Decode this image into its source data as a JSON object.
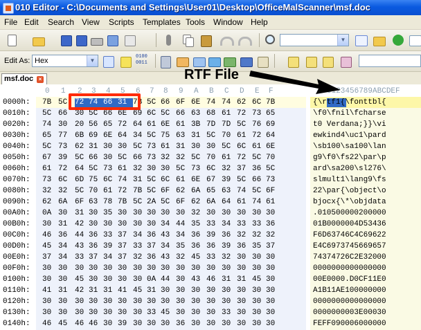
{
  "window": {
    "title": "010 Editor - C:\\Documents and Settings\\User01\\Desktop\\OfficeMalScanner\\msf.doc"
  },
  "menu": [
    "File",
    "Edit",
    "Search",
    "View",
    "Scripts",
    "Templates",
    "Tools",
    "Window",
    "Help"
  ],
  "toolbar": {
    "edit_as_label": "Edit As:",
    "edit_as_value": "Hex",
    "binary_icon_text": "0100\n0011"
  },
  "tab": {
    "label": "msf.doc"
  },
  "annotation": {
    "label": "RTF File"
  },
  "hex": {
    "column_headers": [
      "0",
      "1",
      "2",
      "3",
      "4",
      "5",
      "6",
      "7",
      "8",
      "9",
      "A",
      "B",
      "C",
      "D",
      "E",
      "F"
    ],
    "ascii_header": "0123456789ABCDEF",
    "rows": [
      {
        "addr": "0000h:",
        "bytes": [
          "7B",
          "5C",
          "72",
          "74",
          "66",
          "31",
          "7B",
          "5C",
          "66",
          "6F",
          "6E",
          "74",
          "74",
          "62",
          "6C",
          "7B"
        ],
        "ascii": "{\\rtf1{\\fonttbl{"
      },
      {
        "addr": "0010h:",
        "bytes": [
          "5C",
          "66",
          "30",
          "5C",
          "66",
          "6E",
          "69",
          "6C",
          "5C",
          "66",
          "63",
          "68",
          "61",
          "72",
          "73",
          "65"
        ],
        "ascii": "\\f0\\fnil\\fcharse"
      },
      {
        "addr": "0020h:",
        "bytes": [
          "74",
          "30",
          "20",
          "56",
          "65",
          "72",
          "64",
          "61",
          "6E",
          "61",
          "3B",
          "7D",
          "7D",
          "5C",
          "76",
          "69"
        ],
        "ascii": "t0 Verdana;}}\\vi"
      },
      {
        "addr": "0030h:",
        "bytes": [
          "65",
          "77",
          "6B",
          "69",
          "6E",
          "64",
          "34",
          "5C",
          "75",
          "63",
          "31",
          "5C",
          "70",
          "61",
          "72",
          "64"
        ],
        "ascii": "ewkind4\\uc1\\pard"
      },
      {
        "addr": "0040h:",
        "bytes": [
          "5C",
          "73",
          "62",
          "31",
          "30",
          "30",
          "5C",
          "73",
          "61",
          "31",
          "30",
          "30",
          "5C",
          "6C",
          "61",
          "6E"
        ],
        "ascii": "\\sb100\\sa100\\lan"
      },
      {
        "addr": "0050h:",
        "bytes": [
          "67",
          "39",
          "5C",
          "66",
          "30",
          "5C",
          "66",
          "73",
          "32",
          "32",
          "5C",
          "70",
          "61",
          "72",
          "5C",
          "70"
        ],
        "ascii": "g9\\f0\\fs22\\par\\p"
      },
      {
        "addr": "0060h:",
        "bytes": [
          "61",
          "72",
          "64",
          "5C",
          "73",
          "61",
          "32",
          "30",
          "30",
          "5C",
          "73",
          "6C",
          "32",
          "37",
          "36",
          "5C"
        ],
        "ascii": "ard\\sa200\\sl276\\"
      },
      {
        "addr": "0070h:",
        "bytes": [
          "73",
          "6C",
          "6D",
          "75",
          "6C",
          "74",
          "31",
          "5C",
          "6C",
          "61",
          "6E",
          "67",
          "39",
          "5C",
          "66",
          "73"
        ],
        "ascii": "slmult1\\lang9\\fs"
      },
      {
        "addr": "0080h:",
        "bytes": [
          "32",
          "32",
          "5C",
          "70",
          "61",
          "72",
          "7B",
          "5C",
          "6F",
          "62",
          "6A",
          "65",
          "63",
          "74",
          "5C",
          "6F"
        ],
        "ascii": "22\\par{\\object\\o"
      },
      {
        "addr": "0090h:",
        "bytes": [
          "62",
          "6A",
          "6F",
          "63",
          "78",
          "7B",
          "5C",
          "2A",
          "5C",
          "6F",
          "62",
          "6A",
          "64",
          "61",
          "74",
          "61"
        ],
        "ascii": "bjocx{\\*\\objdata"
      },
      {
        "addr": "00A0h:",
        "bytes": [
          "0A",
          "30",
          "31",
          "30",
          "35",
          "30",
          "30",
          "30",
          "30",
          "30",
          "32",
          "30",
          "30",
          "30",
          "30",
          "30"
        ],
        "ascii": ".010500000200000"
      },
      {
        "addr": "00B0h:",
        "bytes": [
          "30",
          "31",
          "42",
          "30",
          "30",
          "30",
          "30",
          "30",
          "34",
          "44",
          "35",
          "33",
          "34",
          "33",
          "33",
          "36"
        ],
        "ascii": "01B0000004D53436"
      },
      {
        "addr": "00C0h:",
        "bytes": [
          "46",
          "36",
          "44",
          "36",
          "33",
          "37",
          "34",
          "36",
          "43",
          "34",
          "36",
          "39",
          "36",
          "32",
          "32",
          "32"
        ],
        "ascii": "F6D63746C4C69622"
      },
      {
        "addr": "00D0h:",
        "bytes": [
          "45",
          "34",
          "43",
          "36",
          "39",
          "37",
          "33",
          "37",
          "34",
          "35",
          "36",
          "36",
          "39",
          "36",
          "35",
          "37"
        ],
        "ascii": "E4C6973745669657"
      },
      {
        "addr": "00E0h:",
        "bytes": [
          "37",
          "34",
          "33",
          "37",
          "34",
          "37",
          "32",
          "36",
          "43",
          "32",
          "45",
          "33",
          "32",
          "30",
          "30",
          "30"
        ],
        "ascii": "74374726C2E32000"
      },
      {
        "addr": "00F0h:",
        "bytes": [
          "30",
          "30",
          "30",
          "30",
          "30",
          "30",
          "30",
          "30",
          "30",
          "30",
          "30",
          "30",
          "30",
          "30",
          "30",
          "30"
        ],
        "ascii": "0000000000000000"
      },
      {
        "addr": "0100h:",
        "bytes": [
          "30",
          "30",
          "45",
          "30",
          "30",
          "30",
          "30",
          "0A",
          "44",
          "30",
          "43",
          "46",
          "31",
          "31",
          "45",
          "30"
        ],
        "ascii": "00E0000.D0CF11E0"
      },
      {
        "addr": "0110h:",
        "bytes": [
          "41",
          "31",
          "42",
          "31",
          "31",
          "41",
          "45",
          "31",
          "30",
          "30",
          "30",
          "30",
          "30",
          "30",
          "30",
          "30"
        ],
        "ascii": "A1B11AE100000000"
      },
      {
        "addr": "0120h:",
        "bytes": [
          "30",
          "30",
          "30",
          "30",
          "30",
          "30",
          "30",
          "30",
          "30",
          "30",
          "30",
          "30",
          "30",
          "30",
          "30",
          "30"
        ],
        "ascii": "0000000000000000"
      },
      {
        "addr": "0130h:",
        "bytes": [
          "30",
          "30",
          "30",
          "30",
          "30",
          "30",
          "30",
          "33",
          "45",
          "30",
          "30",
          "30",
          "33",
          "30",
          "30",
          "30"
        ],
        "ascii": "0000000003E00030"
      },
      {
        "addr": "0140h:",
        "bytes": [
          "46",
          "45",
          "46",
          "46",
          "30",
          "39",
          "30",
          "30",
          "30",
          "36",
          "30",
          "30",
          "30",
          "30",
          "30",
          "30"
        ],
        "ascii": "FEFF090006000000"
      }
    ]
  },
  "colors": {
    "selection": "#316ac5",
    "highlight_box": "#ff2a00",
    "ascii_bg": "#fafae4"
  }
}
